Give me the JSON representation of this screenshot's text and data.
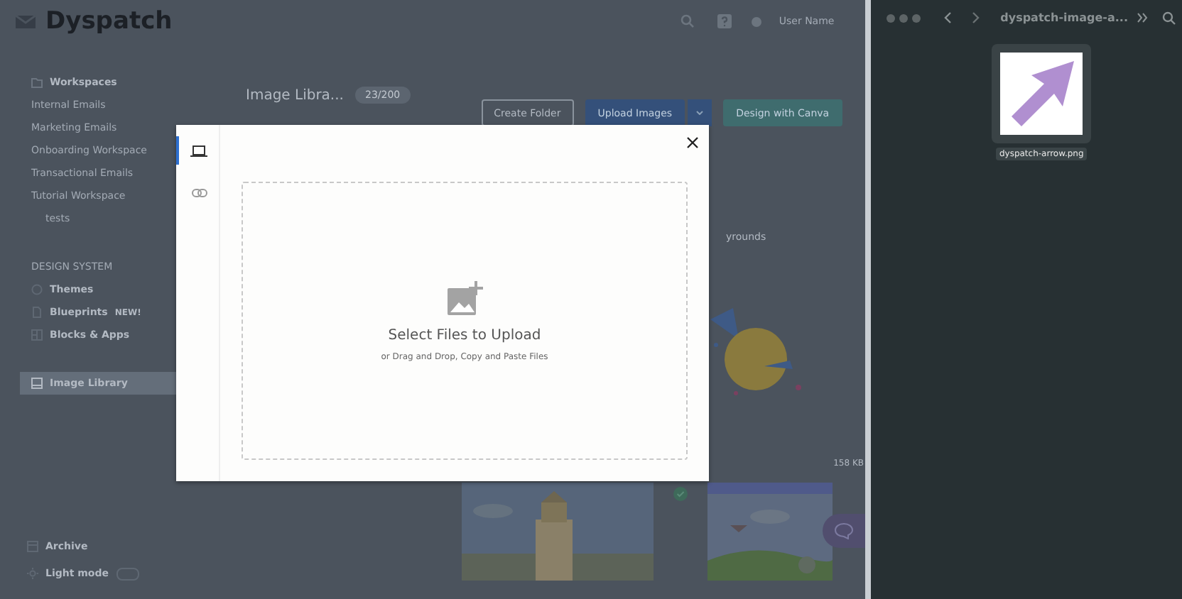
{
  "app": {
    "logo": "Dyspatch",
    "user": "User Name"
  },
  "sidebar": {
    "workspaces_label": "Workspaces",
    "workspaces": [
      {
        "label": "Internal Emails"
      },
      {
        "label": "Marketing Emails"
      },
      {
        "label": "Onboarding Workspace"
      },
      {
        "label": "Transactional Emails"
      },
      {
        "label": "Tutorial Workspace"
      }
    ],
    "sub_items": [
      {
        "label": "tests"
      }
    ],
    "design_heading": "DESIGN SYSTEM",
    "design_items": [
      {
        "kind": "themes",
        "label": "Themes"
      },
      {
        "kind": "blueprints",
        "label": "Blueprints",
        "badge": "NEW!"
      },
      {
        "kind": "blocks",
        "label": "Blocks & Apps"
      }
    ],
    "library": {
      "label": "Image Library",
      "selected": true
    },
    "archive": "Archive",
    "light_mode": {
      "label": "Light mode",
      "on": false
    }
  },
  "content": {
    "title": "Image Libra...",
    "count": "23/200",
    "buttons": [
      {
        "kind": "outline",
        "label": "Create Folder"
      },
      {
        "kind": "primary",
        "label": "Upload Images"
      },
      {
        "kind": "canva",
        "label": "Design with Canva"
      }
    ],
    "card_title": "yrounds",
    "card_size": "158 KB"
  },
  "modal": {
    "sources": [
      {
        "kind": "computer",
        "selected": true
      },
      {
        "kind": "link",
        "selected": false
      }
    ],
    "title": "Select Files to Upload",
    "hint": "or Drag and Drop, Copy and Paste Files"
  },
  "finder": {
    "title": "dyspatch-image-a...",
    "file": "dyspatch-arrow.png"
  }
}
